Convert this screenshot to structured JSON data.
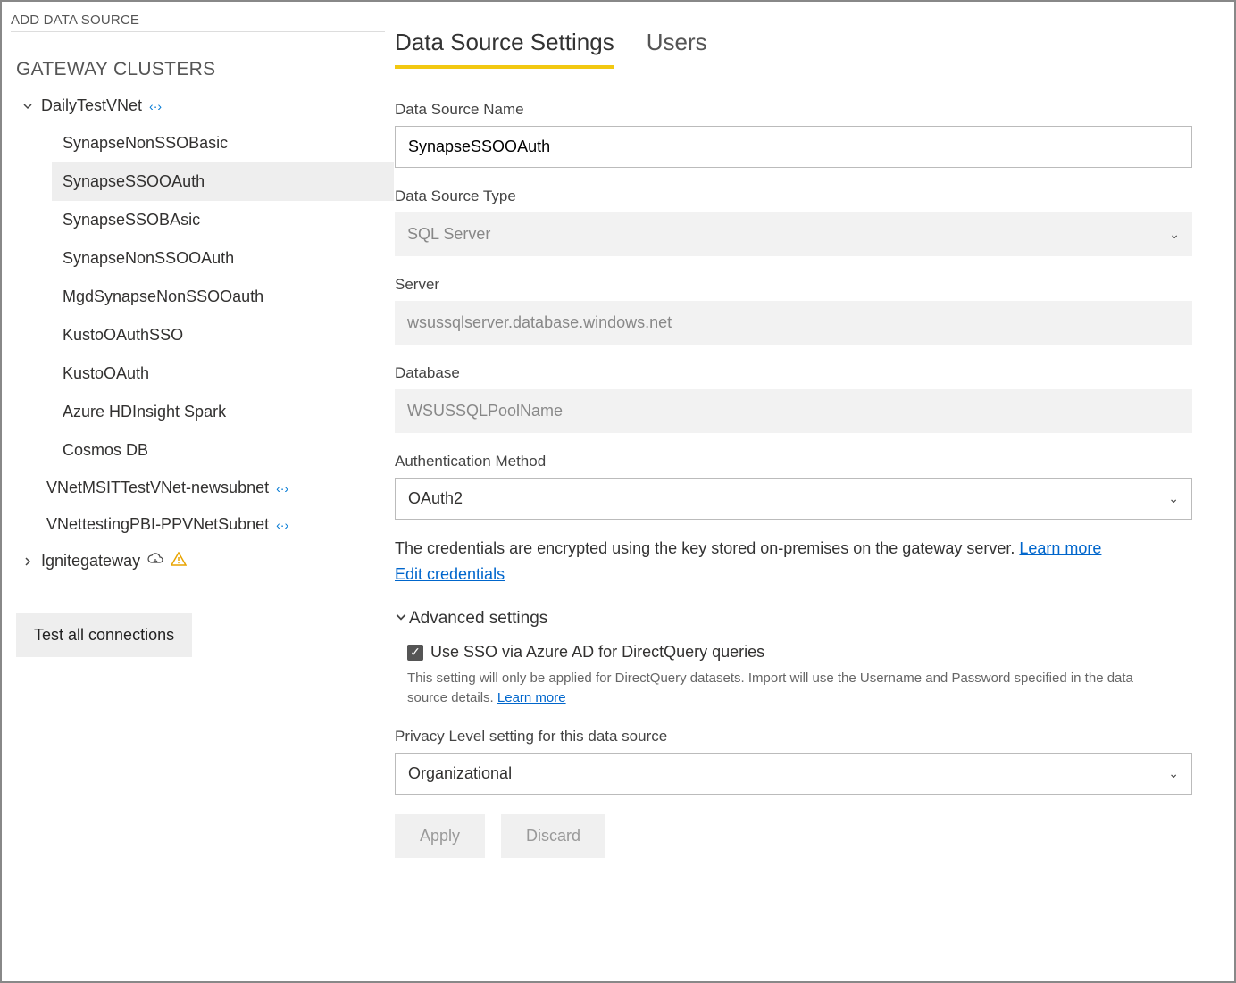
{
  "sidebar": {
    "add_label": "ADD DATA SOURCE",
    "section_title": "GATEWAY CLUSTERS",
    "clusters": [
      {
        "name": "DailyTestVNet",
        "expanded": true,
        "link": true,
        "children": [
          "SynapseNonSSOBasic",
          "SynapseSSOOAuth",
          "SynapseSSOBAsic",
          "SynapseNonSSOOAuth",
          "MgdSynapseNonSSOOauth",
          "KustoOAuthSSO",
          "KustoOAuth",
          "Azure HDInsight Spark",
          "Cosmos DB"
        ],
        "selected_child": "SynapseSSOOAuth"
      },
      {
        "name": "VNetMSITTestVNet-newsubnet",
        "link": true
      },
      {
        "name": "VNettestingPBI-PPVNetSubnet",
        "link": true
      },
      {
        "name": "Ignitegateway",
        "cloud": true,
        "warn": true,
        "collapsed": true
      }
    ],
    "test_button": "Test all connections"
  },
  "tabs": {
    "settings": "Data Source Settings",
    "users": "Users",
    "active": "settings"
  },
  "form": {
    "name_label": "Data Source Name",
    "name_value": "SynapseSSOOAuth",
    "type_label": "Data Source Type",
    "type_value": "SQL Server",
    "server_label": "Server",
    "server_value": "wsussqlserver.database.windows.net",
    "database_label": "Database",
    "database_value": "WSUSSQLPoolName",
    "auth_label": "Authentication Method",
    "auth_value": "OAuth2",
    "encrypt_text": "The credentials are encrypted using the key stored on-premises on the gateway server. ",
    "learn_more": "Learn more",
    "edit_credentials": "Edit credentials",
    "advanced_label": "Advanced settings",
    "sso_checkbox_label": "Use SSO via Azure AD for DirectQuery queries",
    "sso_checked": true,
    "sso_help": "This setting will only be applied for DirectQuery datasets. Import will use the Username and Password specified in the data source details. ",
    "privacy_label": "Privacy Level setting for this data source",
    "privacy_value": "Organizational",
    "apply": "Apply",
    "discard": "Discard"
  }
}
